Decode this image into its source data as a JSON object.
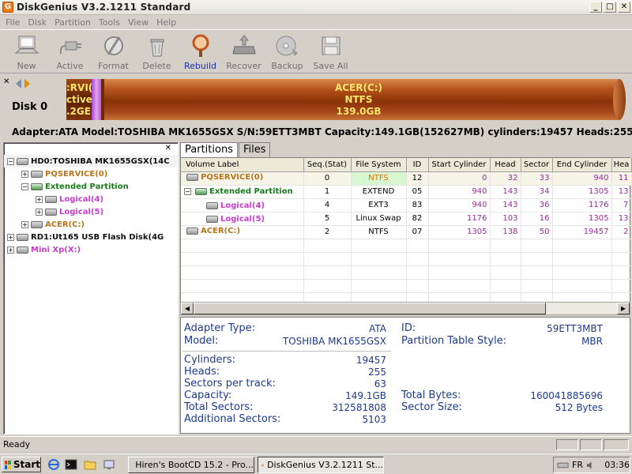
{
  "window": {
    "title": "DiskGenius V3.2.1211 Standard",
    "app_icon": "G"
  },
  "menu": [
    "File",
    "Disk",
    "Partition",
    "Tools",
    "View",
    "Help"
  ],
  "toolbar": [
    {
      "label": "New",
      "icon": "computer-icon"
    },
    {
      "label": "Active",
      "icon": "plug-icon"
    },
    {
      "label": "Format",
      "icon": "format-icon"
    },
    {
      "label": "Delete",
      "icon": "trash-icon"
    },
    {
      "label": "Rebuild",
      "icon": "magnifier-icon"
    },
    {
      "label": "Recover",
      "icon": "recover-icon"
    },
    {
      "label": "Backup",
      "icon": "backup-icon"
    },
    {
      "label": "Save All",
      "icon": "save-icon"
    }
  ],
  "disk_strip": {
    "disk_label": "Disk  0",
    "partition1_lines": [
      ":RVI(",
      "ctive",
      ".2GE"
    ],
    "partition2_lines": [
      "ACER(C:)",
      "NTFS",
      "139.0GB"
    ]
  },
  "disk_info": "Adapter:ATA  Model:TOSHIBA MK1655GSX  S/N:59ETT3MBT  Capacity:149.1GB(152627MB)  cylinders:19457  Heads:255",
  "tree": [
    {
      "indent": 0,
      "expander": "−",
      "glyph": "gray",
      "text": "HD0:TOSHIBA MK1655GSX(14C",
      "color": "black"
    },
    {
      "indent": 1,
      "expander": "+",
      "glyph": "gray",
      "text": "PQSERVICE(0)",
      "color": "orange"
    },
    {
      "indent": 1,
      "expander": "−",
      "glyph": "green",
      "text": "Extended Partition",
      "color": "green"
    },
    {
      "indent": 2,
      "expander": "+",
      "glyph": "gray",
      "text": "Logical(4)",
      "color": "purple"
    },
    {
      "indent": 2,
      "expander": "+",
      "glyph": "gray",
      "text": "Logical(5)",
      "color": "purple"
    },
    {
      "indent": 1,
      "expander": "+",
      "glyph": "gray",
      "text": "ACER(C:)",
      "color": "orange"
    },
    {
      "indent": 0,
      "expander": "+",
      "glyph": "gray",
      "text": "RD1:Ut165     USB Flash Disk(4G",
      "color": "black"
    },
    {
      "indent": 0,
      "expander": "+",
      "glyph": "gray",
      "text": "Mini Xp(X:)",
      "color": "purple"
    }
  ],
  "tabs": [
    "Partitions",
    "Files"
  ],
  "table": {
    "headers": [
      "Volume Label",
      "Seq.(Stat)",
      "File System",
      "ID",
      "Start Cylinder",
      "Head",
      "Sector",
      "End Cylinder",
      "Hea"
    ],
    "rows": [
      {
        "label": "PQSERVICE(0)",
        "color": "orange",
        "expander": "",
        "indent": 0,
        "seq": "0",
        "fs": "NTFS",
        "fs_hi": true,
        "id": "12",
        "start_cyl": "0",
        "head": "32",
        "sector": "33",
        "end_cyl": "940",
        "end_head": "11"
      },
      {
        "label": "Extended Partition",
        "color": "green",
        "expander": "−",
        "indent": 0,
        "seq": "1",
        "fs": "EXTEND",
        "fs_hi": false,
        "id": "05",
        "start_cyl": "940",
        "head": "143",
        "sector": "34",
        "end_cyl": "1305",
        "end_head": "13"
      },
      {
        "label": "Logical(4)",
        "color": "purple",
        "expander": "",
        "indent": 1,
        "seq": "4",
        "fs": "EXT3",
        "fs_hi": false,
        "id": "83",
        "start_cyl": "940",
        "head": "143",
        "sector": "36",
        "end_cyl": "1176",
        "end_head": "7"
      },
      {
        "label": "Logical(5)",
        "color": "purple",
        "expander": "",
        "indent": 1,
        "seq": "5",
        "fs": "Linux Swap",
        "fs_hi": false,
        "id": "82",
        "start_cyl": "1176",
        "head": "103",
        "sector": "16",
        "end_cyl": "1305",
        "end_head": "13"
      },
      {
        "label": "ACER(C:)",
        "color": "orange",
        "expander": "",
        "indent": 0,
        "seq": "2",
        "fs": "NTFS",
        "fs_hi": false,
        "id": "07",
        "start_cyl": "1305",
        "head": "138",
        "sector": "50",
        "end_cyl": "19457",
        "end_head": "2"
      }
    ]
  },
  "info": {
    "adapter_type_label": "Adapter Type:",
    "adapter_type": "ATA",
    "model_label": "Model:",
    "model": "TOSHIBA MK1655GSX",
    "id_label": "ID:",
    "id": "59ETT3MBT",
    "pts_label": "Partition Table Style:",
    "pts": "MBR",
    "cylinders_label": "Cylinders:",
    "cylinders": "19457",
    "heads_label": "Heads:",
    "heads": "255",
    "spt_label": "Sectors per track:",
    "spt": "63",
    "capacity_label": "Capacity:",
    "capacity": "149.1GB",
    "total_bytes_label": "Total Bytes:",
    "total_bytes": "160041885696",
    "total_sectors_label": "Total Sectors:",
    "total_sectors": "312581808",
    "sector_size_label": "Sector Size:",
    "sector_size": "512 Bytes",
    "additional_label": "Additional Sectors:",
    "additional": "5103"
  },
  "status": {
    "text": "Ready"
  },
  "taskbar": {
    "start": "Start",
    "task1": "Hiren's BootCD 15.2 - Pro...",
    "task2": "DiskGenius V3.2.1211 St...",
    "lang": "FR",
    "clock": "03:36"
  }
}
